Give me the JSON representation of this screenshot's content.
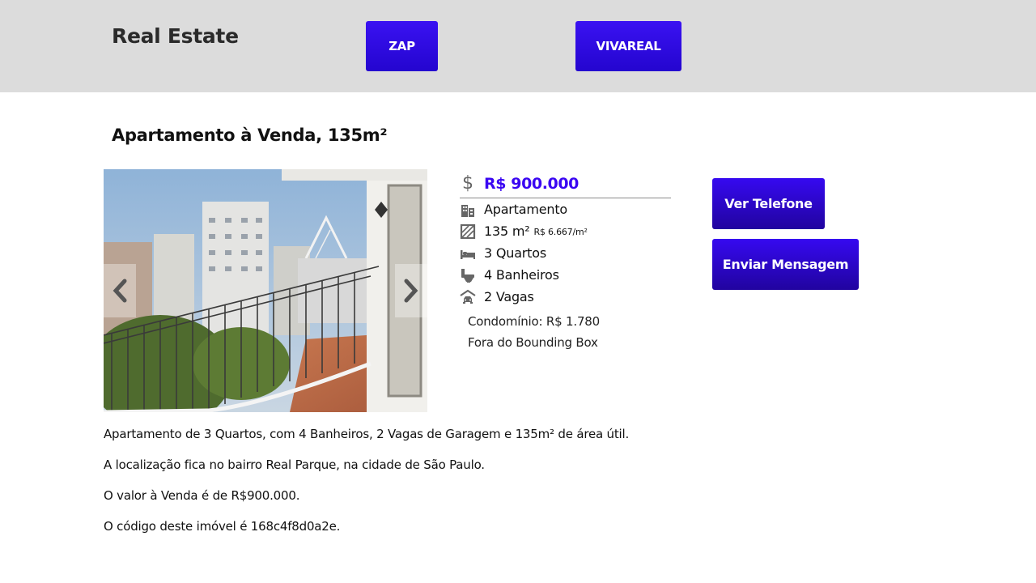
{
  "header": {
    "brand": "Real Estate",
    "buttons": {
      "zap": "ZAP",
      "vivareal": "VIVAREAL"
    }
  },
  "listing": {
    "title": "Apartamento à Venda, 135m²",
    "price": "R$ 900.000",
    "features": {
      "type": "Apartamento",
      "area": "135 m²",
      "area_price": "R$ 6.667/m²",
      "bedrooms": "3 Quartos",
      "bathrooms": "4 Banheiros",
      "parking": "2 Vagas"
    },
    "condominio": "Condomínio: R$ 1.780",
    "extra_note": "Fora do Bounding Box"
  },
  "actions": {
    "phone": "Ver Telefone",
    "message": "Enviar Mensagem"
  },
  "description": [
    "Apartamento de 3 Quartos, com 4 Banheiros, 2 Vagas de Garagem e 135m² de área útil.",
    "A localização fica no bairro Real Parque, na cidade de São Paulo.",
    "O valor à Venda é de R$900.000.",
    "O código deste imóvel é 168c4f8d0a2e."
  ],
  "icons": {
    "dollar": "dollar-icon",
    "type": "building-icon",
    "area": "area-icon",
    "bedrooms": "bed-icon",
    "bathrooms": "bath-icon",
    "parking": "garage-icon",
    "prev": "chevron-left-icon",
    "next": "chevron-right-icon"
  },
  "colors": {
    "accent": "#3a06f2",
    "button": "#2a07d8",
    "header_bg": "#dcdcdc",
    "icon": "#666666"
  }
}
